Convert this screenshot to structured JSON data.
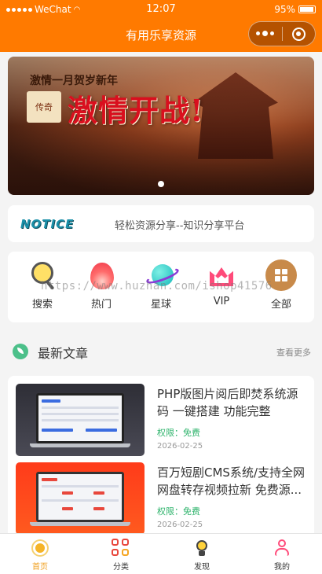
{
  "status": {
    "carrier": "WeChat",
    "time": "12:07",
    "battery": "95%"
  },
  "nav": {
    "title": "有用乐享资源"
  },
  "banner": {
    "small_text": "激情一月贺岁新年",
    "big_text": "激情开战!",
    "seal_text": "传奇",
    "active_index": 0
  },
  "notice": {
    "logo": "NOTICE",
    "text": "轻松资源分享--知识分享平台"
  },
  "menu": {
    "items": [
      {
        "label": "搜索",
        "icon": "search-icon"
      },
      {
        "label": "热门",
        "icon": "flame-icon"
      },
      {
        "label": "星球",
        "icon": "planet-icon"
      },
      {
        "label": "VIP",
        "icon": "crown-icon"
      },
      {
        "label": "全部",
        "icon": "grid-icon"
      }
    ]
  },
  "watermark": "https://www.huzhan.com/ishop41576",
  "section": {
    "title": "最新文章",
    "more": "查看更多"
  },
  "articles": [
    {
      "title": "PHP版图片阅后即焚系统源码 一键搭建 功能完整",
      "perm": "权限：免费",
      "date": "2026-02-25"
    },
    {
      "title": "百万短剧CMS系统/支持全网网盘转存视频拉新 免费源...",
      "perm": "权限：免费",
      "date": "2026-02-25"
    }
  ],
  "tabbar": {
    "items": [
      {
        "label": "首页",
        "icon": "sun-icon",
        "active": true
      },
      {
        "label": "分类",
        "icon": "category-icon",
        "active": false
      },
      {
        "label": "发现",
        "icon": "bulb-icon",
        "active": false
      },
      {
        "label": "我的",
        "icon": "user-icon",
        "active": false
      }
    ]
  },
  "colors": {
    "primary": "#ff7a00",
    "accent_green": "#2db36b",
    "tab_active": "#f0a020"
  }
}
